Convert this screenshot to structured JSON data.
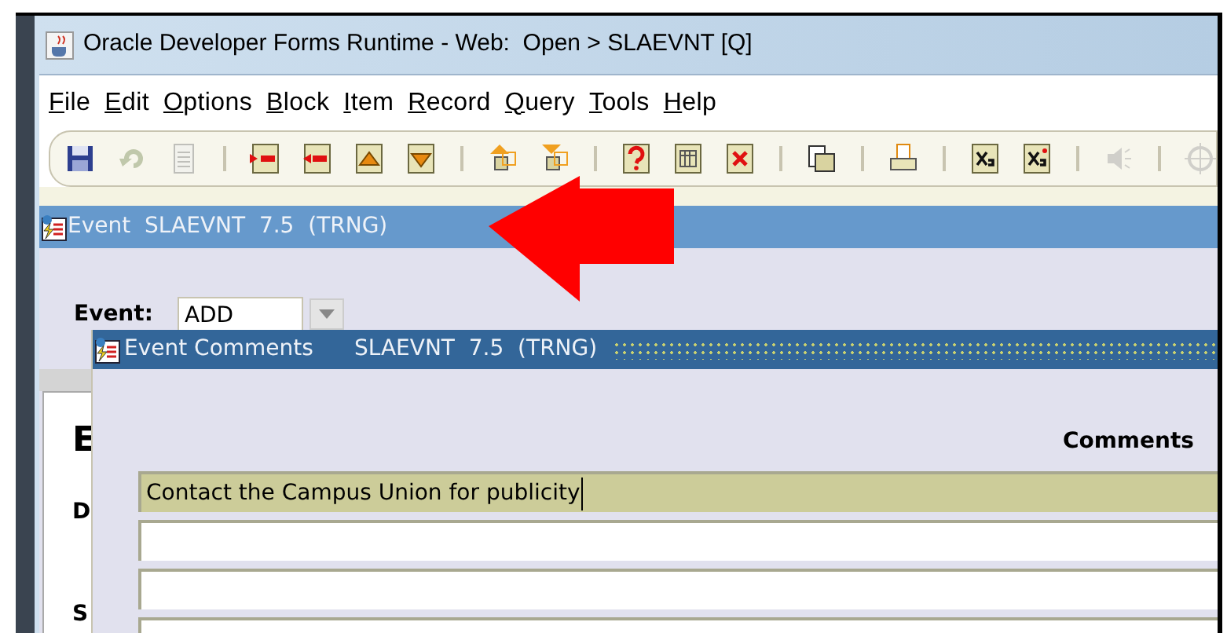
{
  "window": {
    "title": "Oracle Developer Forms Runtime - Web:  Open > SLAEVNT [Q]"
  },
  "menu": [
    "File",
    "Edit",
    "Options",
    "Block",
    "Item",
    "Record",
    "Query",
    "Tools",
    "Help"
  ],
  "form": {
    "title": "Event  SLAEVNT  7.5  (TRNG)",
    "event_label": "Event:",
    "event_value": "ADD",
    "partial_labels": [
      "E",
      "D",
      "S"
    ]
  },
  "comments_window": {
    "title": "Event Comments",
    "subtitle": "SLAEVNT  7.5  (TRNG)",
    "column_heading": "Comments",
    "rows": [
      {
        "text": "Contact the Campus Union for publicity",
        "selected": true
      },
      {
        "selected": false
      },
      {
        "selected": false
      },
      {
        "selected": false
      }
    ]
  }
}
